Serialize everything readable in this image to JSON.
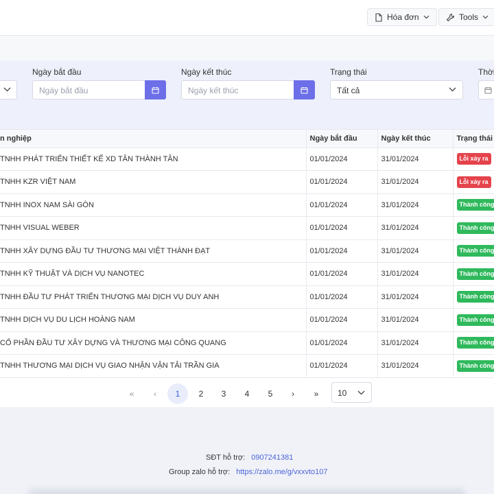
{
  "topbar": {
    "invoice_label": "Hóa đơn",
    "tools_label": "Tools",
    "invoice_icon": "document-icon",
    "tools_icon": "wrench-icon"
  },
  "filters": {
    "start_date": {
      "label": "Ngày bắt đầu",
      "placeholder": "Ngày bắt đầu"
    },
    "end_date": {
      "label": "Ngày kết thúc",
      "placeholder": "Ngày kết thúc"
    },
    "status": {
      "label": "Trạng thái",
      "value": "Tất cả"
    },
    "time": {
      "label": "Thời"
    }
  },
  "table": {
    "headers": [
      "n nghiệp",
      "Ngày bắt đầu",
      "Ngày kết thúc",
      "Trạng thái"
    ],
    "rows": [
      {
        "company": "TNHH PHÁT TRIỂN THIẾT KẾ XD TÂN THÀNH TÂN",
        "start": "01/01/2024",
        "end": "31/01/2024",
        "status": "Lỗi xảy ra"
      },
      {
        "company": "TNHH KZR VIỆT NAM",
        "start": "01/01/2024",
        "end": "31/01/2024",
        "status": "Lỗi xảy ra"
      },
      {
        "company": "TNHH INOX NAM SÀI GÒN",
        "start": "01/01/2024",
        "end": "31/01/2024",
        "status": "Thành công"
      },
      {
        "company": "TNHH VISUAL WEBER",
        "start": "01/01/2024",
        "end": "31/01/2024",
        "status": "Thành công"
      },
      {
        "company": "TNHH XÂY DỰNG ĐẦU TƯ THƯƠNG MẠI VIỆT THÀNH ĐẠT",
        "start": "01/01/2024",
        "end": "31/01/2024",
        "status": "Thành công"
      },
      {
        "company": "TNHH KỸ THUẬT VÀ DỊCH VỤ NANOTEC",
        "start": "01/01/2024",
        "end": "31/01/2024",
        "status": "Thành công"
      },
      {
        "company": "TNHH ĐẦU TƯ PHÁT TRIỂN THƯƠNG MẠI DỊCH VỤ DUY ANH",
        "start": "01/01/2024",
        "end": "31/01/2024",
        "status": "Thành công"
      },
      {
        "company": "TNHH DỊCH VỤ DU LỊCH HOÀNG NAM",
        "start": "01/01/2024",
        "end": "31/01/2024",
        "status": "Thành công"
      },
      {
        "company": "CỔ PHẦN ĐẦU TƯ XÂY DỰNG VÀ THƯƠNG MẠI CÔNG QUANG",
        "start": "01/01/2024",
        "end": "31/01/2024",
        "status": "Thành công"
      },
      {
        "company": "TNHH THƯƠNG MẠI DỊCH VỤ GIAO NHẬN VẬN TẢI TRẦN GIA",
        "start": "01/01/2024",
        "end": "31/01/2024",
        "status": "Thành công"
      }
    ]
  },
  "pagination": {
    "first": "«",
    "prev": "‹",
    "pages": [
      "1",
      "2",
      "3",
      "4",
      "5"
    ],
    "current": "1",
    "next": "›",
    "last": "»",
    "page_size": "10"
  },
  "footer": {
    "phone_label": "SĐT hỗ trợ:",
    "phone_value": "0907241381",
    "zalo_label": "Group zalo hỗ trợ:",
    "zalo_value": "https://zalo.me/g/vxxvto107"
  },
  "colors": {
    "accent": "#6d6fe8",
    "success": "#2fb95c",
    "error": "#e5434b",
    "link": "#4b63d8"
  }
}
